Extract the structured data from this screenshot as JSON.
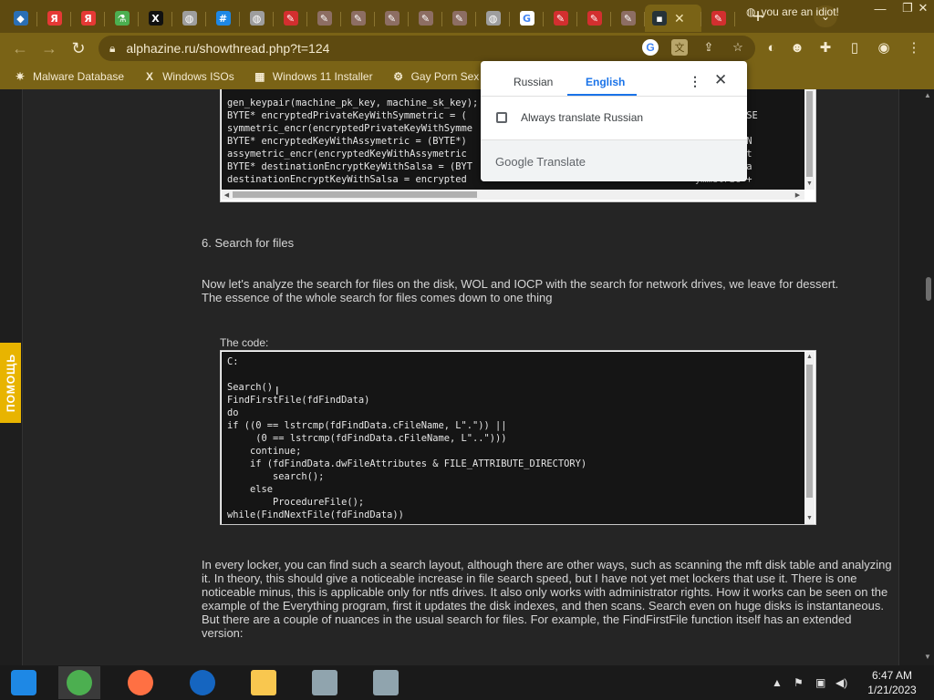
{
  "browser": {
    "tabs": [
      {
        "icon": "blue-hex-icon",
        "color": "#2a6fb5",
        "glyph": "◆"
      },
      {
        "icon": "yandex-icon",
        "color": "#e53935",
        "glyph": "Я"
      },
      {
        "icon": "yandex-icon",
        "color": "#e53935",
        "glyph": "Я"
      },
      {
        "icon": "flask-icon",
        "color": "#4caf50",
        "glyph": "⚗"
      },
      {
        "icon": "x-logo-icon",
        "color": "#111111",
        "glyph": "X"
      },
      {
        "icon": "globe-icon",
        "color": "#9e9e9e",
        "glyph": "◍"
      },
      {
        "icon": "hash-icon",
        "color": "#1e88e5",
        "glyph": "#"
      },
      {
        "icon": "globe-icon",
        "color": "#9e9e9e",
        "glyph": "◍"
      },
      {
        "icon": "red-feather-icon",
        "color": "#d32f2f",
        "glyph": "✎"
      },
      {
        "icon": "feather-icon",
        "color": "#8d6e63",
        "glyph": "✎"
      },
      {
        "icon": "feather-icon",
        "color": "#8d6e63",
        "glyph": "✎"
      },
      {
        "icon": "feather-icon",
        "color": "#8d6e63",
        "glyph": "✎"
      },
      {
        "icon": "feather-icon",
        "color": "#8d6e63",
        "glyph": "✎"
      },
      {
        "icon": "feather-icon",
        "color": "#8d6e63",
        "glyph": "✎"
      },
      {
        "icon": "globe-icon",
        "color": "#9e9e9e",
        "glyph": "◍"
      },
      {
        "icon": "google-icon",
        "color": "#ffffff",
        "glyph": "G"
      },
      {
        "icon": "red-feather-icon",
        "color": "#d32f2f",
        "glyph": "✎"
      },
      {
        "icon": "red-feather-icon",
        "color": "#d32f2f",
        "glyph": "✎"
      },
      {
        "icon": "feather-icon",
        "color": "#8d6e63",
        "glyph": "✎"
      }
    ],
    "active_tab": {
      "icon": "terminal-icon",
      "glyph": "▪",
      "close": "✕"
    },
    "last_tab": {
      "icon": "red-feather-icon",
      "glyph": "✎"
    },
    "new_tab": "+",
    "tab_search": "⌄",
    "window_controls": {
      "minimize": "—",
      "restore": "❐",
      "close": "✕"
    },
    "url": "alphazine.ru/showthread.php?t=124",
    "bookmarks": [
      {
        "label": "Malware Database",
        "icon": "malware-db-icon",
        "glyph": "✷"
      },
      {
        "label": "Windows ISOs",
        "icon": "x-logo-icon",
        "glyph": "X"
      },
      {
        "label": "Windows 11 Installer",
        "icon": "installer-icon",
        "glyph": "▦"
      },
      {
        "label": "Gay Porn Sex Mo",
        "icon": "gear-site-icon",
        "glyph": "⚙"
      }
    ],
    "bookmark_overflow": "you are an idiot!",
    "accent": "#7a6316"
  },
  "translate": {
    "tab_source": "Russian",
    "tab_target": "English",
    "always_label": "Always translate Russian",
    "brand": "Google Translate"
  },
  "page": {
    "top_code": "gen_keypair(machine_pk_key, machine_sk_key);\nBYTE* encryptedPrivateKeyWithSymmetric = (                                         MEMORY, SE\nsymmetric_encr(encryptedPrivateKeyWithSymme                                      //Encrypt\nBYTE* encryptedKeyWithAssymetric = (BYTE*)                                        , TOTAL_EN\nassymetric_encr(encryptedKeyWithAssymetric                                        the symmet\nBYTE* destinationEncryptKeyWithSalsa = (BYT                                       MORY, tota\ndestinationEncryptKeyWithSalsa = encrypted                                        ymmetric +",
    "section_heading": "6. Search for files",
    "intro_paragraph": "Now let's analyze the search for files on the disk, WOL and IOCP with the search for network drives, we leave for dessert.\nThe essence of the whole search for files comes down to one thing",
    "code_label": "The code:",
    "search_code": "C:\n\nSearch()\nFindFirstFile(fdFindData)\ndo\nif ((0 == lstrcmp(fdFindData.cFileName, L\".\")) ||\n     (0 == lstrcmp(fdFindData.cFileName, L\"..\")))\n    continue;\n    if (fdFindData.dwFileAttributes & FILE_ATTRIBUTE_DIRECTORY)\n        search();\n    else\n        ProcedureFile();\nwhile(FindNextFile(fdFindData))",
    "body_paragraph": "In every locker, you can find such a search layout, although there are other ways, such as scanning the mft disk table and analyzing it. In theory, this should give a noticeable increase in file search speed, but I have not yet met lockers that use it. There is one noticeable minus, this is applicable only for ntfs drives. It also only works with administrator rights. How it works can be seen on the example of the Everything program, first it updates the disk indexes, and then scans. Search even on huge disks is instantaneous.\nBut there are a couple of nuances in the usual search for files. For example, the FindFirstFile function itself has an extended version:",
    "help_tab": "ПОМОЩЬ"
  },
  "taskbar": {
    "apps": [
      {
        "name": "start-button",
        "color": "#1e88e5"
      },
      {
        "name": "chrome-app",
        "color": "#4caf50"
      },
      {
        "name": "firefox-app",
        "color": "#ff7043"
      },
      {
        "name": "obama-logo-app",
        "color": "#1565c0"
      },
      {
        "name": "file-explorer-app",
        "color": "#f9c74f"
      },
      {
        "name": "network-tool-app",
        "color": "#90a4ae"
      },
      {
        "name": "network-tool-app-2",
        "color": "#90a4ae"
      }
    ],
    "tray_icons": {
      "chevron": "▲",
      "flag": "⚑",
      "network": "▣",
      "volume": "◀)"
    },
    "time": "6:47 AM",
    "date": "1/21/2023"
  }
}
